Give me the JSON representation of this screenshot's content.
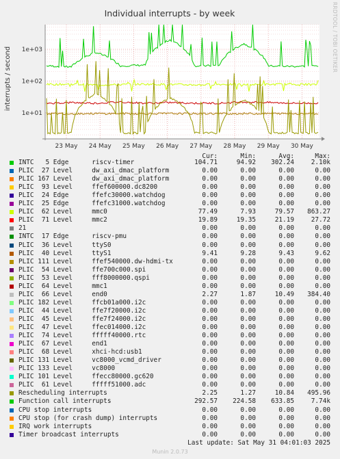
{
  "title": "Individual interrupts - by week",
  "side_label": "RRDTOOL / TOBI OETIKER",
  "footer": {
    "last_update": "Last update: Sat May 31 04:01:03 2025",
    "version": "Munin 2.0.73"
  },
  "table_header": {
    "cur": "Cur:",
    "min": "Min:",
    "avg": "Avg:",
    "max": "Max:"
  },
  "chart_data": {
    "type": "line",
    "title": "Individual interrupts - by week",
    "ylabel": "interrupts / second",
    "y_scale": "log",
    "ylim": [
      1.5,
      6000
    ],
    "y_ticks": [
      {
        "value": 10,
        "label": "1e+01"
      },
      {
        "value": 100,
        "label": "1e+02"
      },
      {
        "value": 1000,
        "label": "1e+03"
      }
    ],
    "x_ticks": [
      "23 May",
      "24 May",
      "25 May",
      "26 May",
      "27 May",
      "28 May",
      "29 May",
      "30 May"
    ],
    "grid": true,
    "legend_placement": "below",
    "series": [
      {
        "name": "riscv-timer",
        "color": "#00cc00",
        "values_approx": [
          300,
          280,
          800,
          300,
          320,
          2000,
          300,
          310,
          1500,
          300,
          290,
          300
        ]
      },
      {
        "name": "mmc0",
        "color": "#ccff00",
        "values_approx": [
          78,
          80,
          75,
          77,
          80,
          78,
          76,
          79,
          77,
          78,
          80,
          77
        ]
      },
      {
        "name": "mmc2",
        "color": "#cc0000",
        "values_approx": [
          20,
          21,
          20,
          22,
          20,
          21,
          20,
          20,
          22,
          21,
          20,
          20
        ]
      },
      {
        "name": "ttyS1",
        "color": "#aa7700",
        "values_approx": [
          9.4,
          9.4,
          9.4,
          9.4,
          9.4,
          9.4,
          9.4,
          9.4,
          9.4,
          9.4,
          9.4,
          9.4
        ]
      },
      {
        "name": "end0",
        "color": "#999900",
        "values_approx": [
          2.3,
          2.3,
          40,
          2.3,
          2.3,
          30,
          2.3,
          2.3,
          25,
          2.3,
          2.3,
          2.3
        ]
      }
    ],
    "rows": [
      {
        "color": "#00cc00",
        "label": "INTC   5 Edge      riscv-timer",
        "cur": "104.71",
        "min": "94.92",
        "avg": "302.24",
        "max": "2.10k"
      },
      {
        "color": "#0066b3",
        "label": "PLIC  27 Level     dw_axi_dmac_platform",
        "cur": "0.00",
        "min": "0.00",
        "avg": "0.00",
        "max": "0.00"
      },
      {
        "color": "#ff8000",
        "label": "PLIC 167 Level     dw_axi_dmac_platform",
        "cur": "0.00",
        "min": "0.00",
        "avg": "0.00",
        "max": "0.00"
      },
      {
        "color": "#ffcc00",
        "label": "PLIC  93 Level     ffef600000.dc8200",
        "cur": "0.00",
        "min": "0.00",
        "avg": "0.00",
        "max": "0.00"
      },
      {
        "color": "#330099",
        "label": "PLIC  24 Edge      ffefc30000.watchdog",
        "cur": "0.00",
        "min": "0.00",
        "avg": "0.00",
        "max": "0.00"
      },
      {
        "color": "#990099",
        "label": "PLIC  25 Edge      ffefc31000.watchdog",
        "cur": "0.00",
        "min": "0.00",
        "avg": "0.00",
        "max": "0.00"
      },
      {
        "color": "#ccff00",
        "label": "PLIC  62 Level     mmc0",
        "cur": "77.49",
        "min": "7.93",
        "avg": "79.57",
        "max": "863.27"
      },
      {
        "color": "#ff0000",
        "label": "PLIC  71 Level     mmc2",
        "cur": "19.89",
        "min": "19.35",
        "avg": "21.19",
        "max": "27.72"
      },
      {
        "color": "#808080",
        "label": "21",
        "cur": "0.00",
        "min": "0.00",
        "avg": "0.00",
        "max": "0.00"
      },
      {
        "color": "#008f00",
        "label": "INTC  17 Edge      riscv-pmu",
        "cur": "0.00",
        "min": "0.00",
        "avg": "0.00",
        "max": "0.00"
      },
      {
        "color": "#00487d",
        "label": "PLIC  36 Level     ttyS0",
        "cur": "0.00",
        "min": "0.00",
        "avg": "0.00",
        "max": "0.00"
      },
      {
        "color": "#b35a00",
        "label": "PLIC  40 Level     ttyS1",
        "cur": "9.41",
        "min": "9.28",
        "avg": "9.43",
        "max": "9.62"
      },
      {
        "color": "#b38f00",
        "label": "PLIC 111 Level     ffef540000.dw-hdmi-tx",
        "cur": "0.00",
        "min": "0.00",
        "avg": "0.00",
        "max": "0.00"
      },
      {
        "color": "#6b006b",
        "label": "PLIC  54 Level     ffe700c000.spi",
        "cur": "0.00",
        "min": "0.00",
        "avg": "0.00",
        "max": "0.00"
      },
      {
        "color": "#8fb300",
        "label": "PLIC  53 Level     fff8000000.qspi",
        "cur": "0.00",
        "min": "0.00",
        "avg": "0.00",
        "max": "0.00"
      },
      {
        "color": "#b30000",
        "label": "PLIC  64 Level     mmc1",
        "cur": "0.00",
        "min": "0.00",
        "avg": "0.00",
        "max": "0.00"
      },
      {
        "color": "#bebebe",
        "label": "PLIC  66 Level     end0",
        "cur": "2.27",
        "min": "1.87",
        "avg": "10.49",
        "max": "384.40"
      },
      {
        "color": "#80ff80",
        "label": "PLIC 182 Level     ffcb01a000.i2c",
        "cur": "0.00",
        "min": "0.00",
        "avg": "0.00",
        "max": "0.00"
      },
      {
        "color": "#80c9ff",
        "label": "PLIC  44 Level     ffe7f20000.i2c",
        "cur": "0.00",
        "min": "0.00",
        "avg": "0.00",
        "max": "0.00"
      },
      {
        "color": "#ffc080",
        "label": "PLIC  45 Level     ffe7f24000.i2c",
        "cur": "0.00",
        "min": "0.00",
        "avg": "0.00",
        "max": "0.00"
      },
      {
        "color": "#ffe680",
        "label": "PLIC  47 Level     ffec014000.i2c",
        "cur": "0.00",
        "min": "0.00",
        "avg": "0.00",
        "max": "0.00"
      },
      {
        "color": "#aa80ff",
        "label": "PLIC  74 Level     fffff40000.rtc",
        "cur": "0.00",
        "min": "0.00",
        "avg": "0.00",
        "max": "0.00"
      },
      {
        "color": "#ee00cc",
        "label": "PLIC  67 Level     end1",
        "cur": "0.00",
        "min": "0.00",
        "avg": "0.00",
        "max": "0.00"
      },
      {
        "color": "#ff8080",
        "label": "PLIC  68 Level     xhci-hcd:usb1",
        "cur": "0.00",
        "min": "0.00",
        "avg": "0.00",
        "max": "0.00"
      },
      {
        "color": "#666600",
        "label": "PLIC 131 Level     vc8000_vcmd_driver",
        "cur": "0.00",
        "min": "0.00",
        "avg": "0.00",
        "max": "0.00"
      },
      {
        "color": "#ffbfff",
        "label": "PLIC 133 Level     vc8000",
        "cur": "0.00",
        "min": "0.00",
        "avg": "0.00",
        "max": "0.00"
      },
      {
        "color": "#00ffcc",
        "label": "PLIC 101 Level     ffecc80000.gc620",
        "cur": "0.00",
        "min": "0.00",
        "avg": "0.00",
        "max": "0.00"
      },
      {
        "color": "#cc6699",
        "label": "PLIC  61 Level     fffff51000.adc",
        "cur": "0.00",
        "min": "0.00",
        "avg": "0.00",
        "max": "0.00"
      },
      {
        "color": "#999900",
        "label": "Rescheduling interrupts",
        "cur": "2.25",
        "min": "1.27",
        "avg": "10.84",
        "max": "495.96"
      },
      {
        "color": "#00cc00",
        "label": "Function call interrupts",
        "cur": "292.57",
        "min": "224.58",
        "avg": "633.85",
        "max": "7.74k"
      },
      {
        "color": "#0066b3",
        "label": "CPU stop interrupts",
        "cur": "0.00",
        "min": "0.00",
        "avg": "0.00",
        "max": "0.00"
      },
      {
        "color": "#ff8000",
        "label": "CPU stop (for crash dump) interrupts",
        "cur": "0.00",
        "min": "0.00",
        "avg": "0.00",
        "max": "0.00"
      },
      {
        "color": "#ffcc00",
        "label": "IRQ work interrupts",
        "cur": "0.00",
        "min": "0.00",
        "avg": "0.00",
        "max": "0.00"
      },
      {
        "color": "#330099",
        "label": "Timer broadcast interrupts",
        "cur": "0.00",
        "min": "0.00",
        "avg": "0.00",
        "max": "0.00"
      }
    ]
  }
}
